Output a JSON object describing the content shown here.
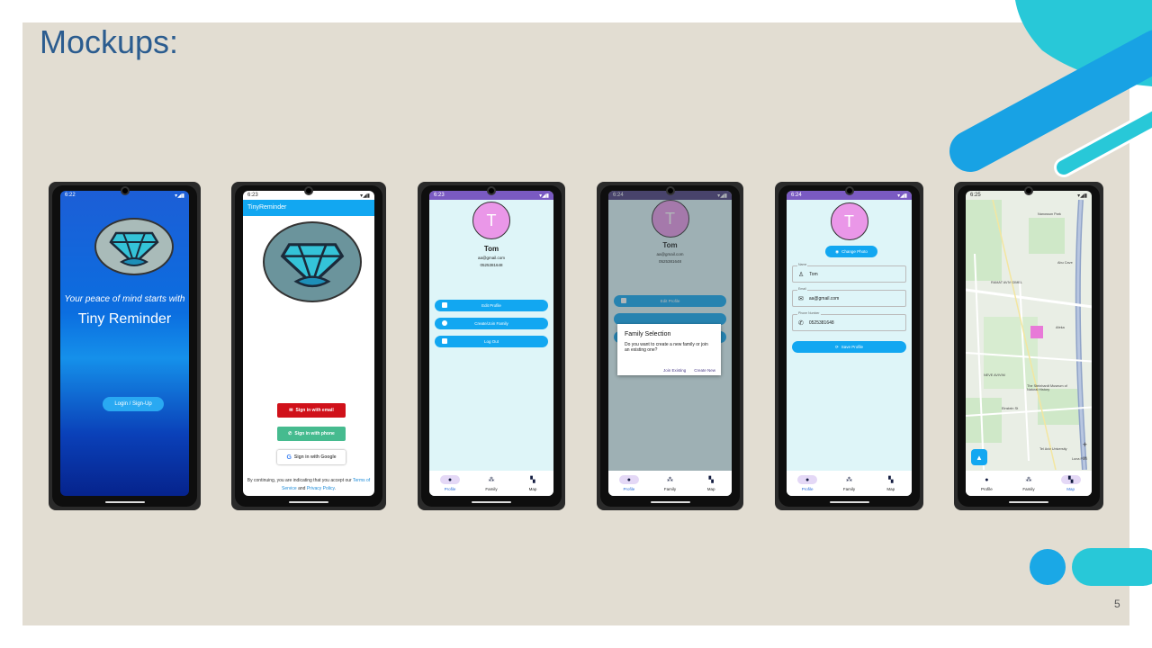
{
  "slide": {
    "title": "Mockups:",
    "page_number": "5"
  },
  "colors": {
    "background": "#e2ddd2",
    "title": "#2b5c8f",
    "accent_blue": "#12a7f1",
    "accent_cyan": "#28c8d8",
    "avatar": "#ea97e8"
  },
  "screen_welcome": {
    "time": "6:22",
    "tagline": "Your peace of mind starts with",
    "app_name": "Tiny Reminder",
    "login_button": "Login / Sign-Up"
  },
  "screen_signin": {
    "time": "6:23",
    "appbar_title": "TinyReminder",
    "email_button": "Sign in with email",
    "phone_button": "Sign in with phone",
    "google_button": "Sign in with Google",
    "terms_prefix": "By continuing, you are indicating that you accept our",
    "terms_link": "Terms of Service",
    "terms_and": "and",
    "privacy_link": "Privacy Policy",
    "terms_end": "."
  },
  "screen_profile": {
    "time": "6:23",
    "avatar_letter": "T",
    "name": "Tom",
    "email": "aa@gmail.com",
    "phone": "0525381648",
    "edit_button": "Edit Profile",
    "family_button": "Create/Join Family",
    "logout_button": "Log Out"
  },
  "screen_family_dialog": {
    "time": "6:24",
    "avatar_letter": "T",
    "name": "Tom",
    "email": "aa@gmail.com",
    "phone": "0525381648",
    "edit_button": "Edit Profile",
    "dialog_title": "Family Selection",
    "dialog_message": "Do you want to create a new family or join an existing one?",
    "join_button": "Join Existing",
    "create_button": "Create New"
  },
  "screen_edit_profile": {
    "time": "6:24",
    "avatar_letter": "T",
    "change_photo_button": "Change Photo",
    "name_label": "Name",
    "name_value": "Tom",
    "email_label": "Email",
    "email_value": "aa@gmail.com",
    "phone_label": "Phone Number",
    "phone_value": "0525381648",
    "save_button": "Save Profile"
  },
  "screen_map": {
    "time": "6:25",
    "labels": [
      "Nanosson Park",
      "RAMAT AVIV GIMEL",
      "Afeka",
      "Abu Cave",
      "NEVE AVIVIM",
      "The Steinhardt Museum of Natural History",
      "Einstein St",
      "Tel Aviv University",
      "Luna Park"
    ],
    "zoom_in": "+",
    "zoom_out": "−"
  },
  "nav": {
    "profile": "Profile",
    "family": "Family",
    "map": "Map"
  }
}
